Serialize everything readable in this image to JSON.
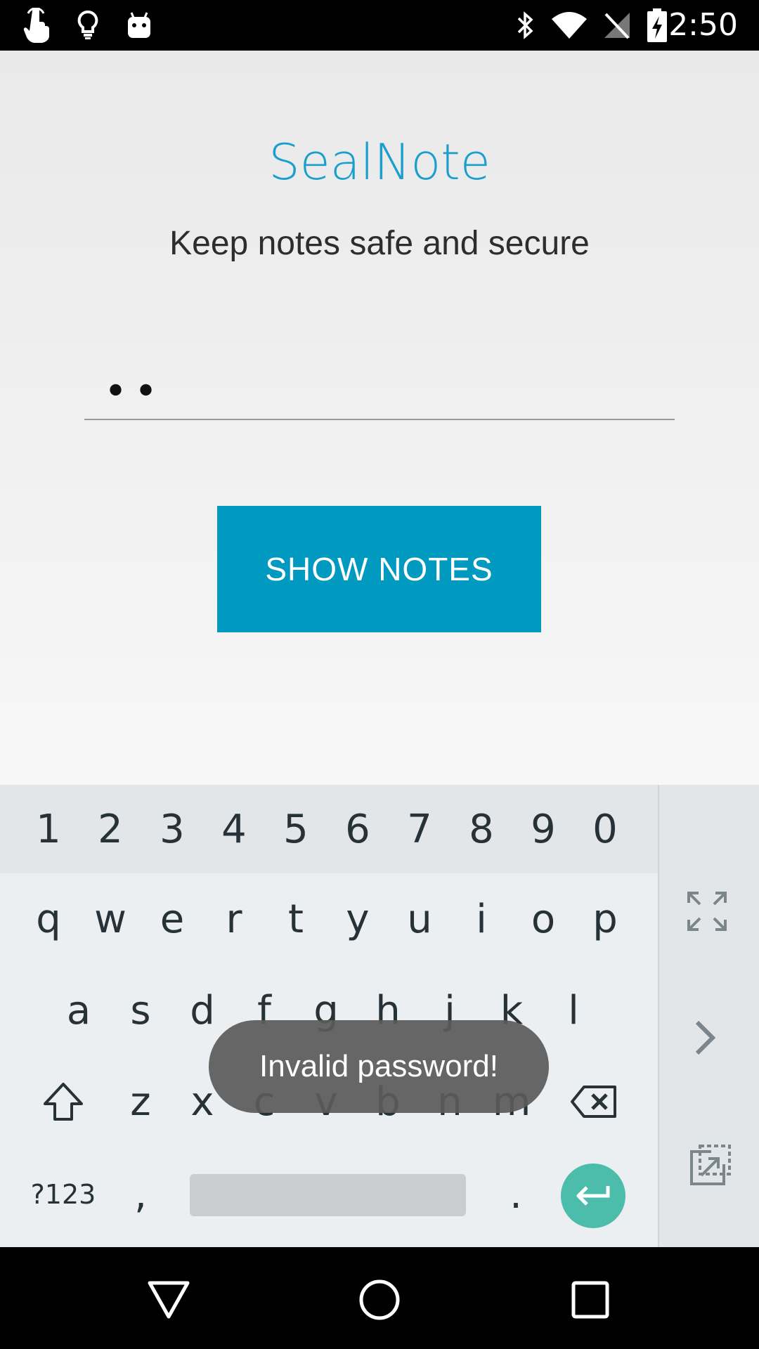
{
  "status_bar": {
    "time": "2:50",
    "left_icons": [
      "touch-icon",
      "lightbulb-icon",
      "android-icon"
    ],
    "right_icons": [
      "bluetooth-icon",
      "wifi-icon",
      "no-signal-icon",
      "battery-charging-icon"
    ]
  },
  "app": {
    "title": "SealNote",
    "subtitle": "Keep notes safe and secure",
    "password_value": "••",
    "show_button_label": "SHOW NOTES",
    "accent_color": "#1a9fcd",
    "button_color": "#0099c0"
  },
  "keyboard": {
    "number_row": [
      "1",
      "2",
      "3",
      "4",
      "5",
      "6",
      "7",
      "8",
      "9",
      "0"
    ],
    "row1": [
      "q",
      "w",
      "e",
      "r",
      "t",
      "y",
      "u",
      "i",
      "o",
      "p"
    ],
    "row2": [
      "a",
      "s",
      "d",
      "f",
      "g",
      "h",
      "j",
      "k",
      "l"
    ],
    "row3": [
      "z",
      "x",
      "c",
      "v",
      "b",
      "n",
      "m"
    ],
    "symbols_label": "?123",
    "comma": ",",
    "period": ".",
    "enter_color": "#4cbcab"
  },
  "toast": {
    "message": "Invalid password!"
  },
  "nav_bar": {
    "buttons": [
      "back-icon",
      "home-icon",
      "recents-icon"
    ]
  }
}
